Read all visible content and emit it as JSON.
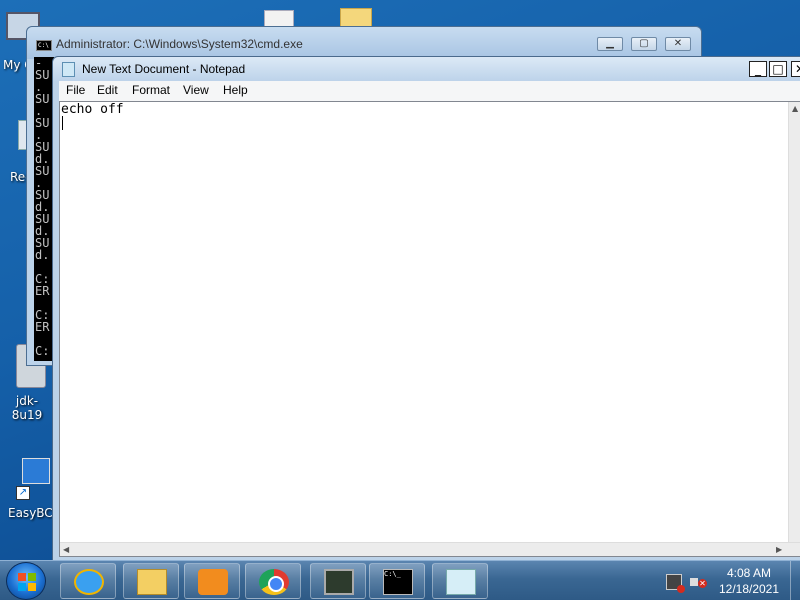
{
  "desktop": {
    "icons": [
      {
        "label": "My C"
      },
      {
        "label": "Rec"
      },
      {
        "label": "jdk-8u19"
      },
      {
        "label": "EasyBCD"
      }
    ]
  },
  "cmd_window": {
    "title": "Administrator: C:\\Windows\\System32\\cmd.exe",
    "console_lines": [
      "-",
      "SU",
      ".",
      "SU",
      ".",
      "SU",
      ".",
      "SU",
      "d.",
      "SU",
      ".",
      "SU",
      "d.",
      "SU",
      "d.",
      "SU",
      "d.",
      "",
      "C:",
      "ER",
      "",
      "C:",
      "ER",
      "",
      "C:"
    ],
    "buttons": {
      "minimize": "▁",
      "maximize": "▢",
      "close": "✕"
    }
  },
  "notepad": {
    "title": "New Text Document - Notepad",
    "menu": {
      "file": "File",
      "edit": "Edit",
      "format": "Format",
      "view": "View",
      "help": "Help"
    },
    "content": "echo off",
    "buttons": {
      "minimize": "_",
      "maximize": "□",
      "close": "✕"
    }
  },
  "taskbar": {
    "apps": [
      "internet-explorer",
      "windows-explorer",
      "media-player",
      "chrome",
      "system-monitor",
      "command-prompt",
      "notepad"
    ],
    "cmd_icon_text": "C:\\_",
    "clock": {
      "time": "4:08 AM",
      "date": "12/18/2021"
    }
  },
  "colors": {
    "desktop": "#1560a9",
    "taskbar": "#3a6793",
    "window_frame": "#bcd2e8"
  }
}
